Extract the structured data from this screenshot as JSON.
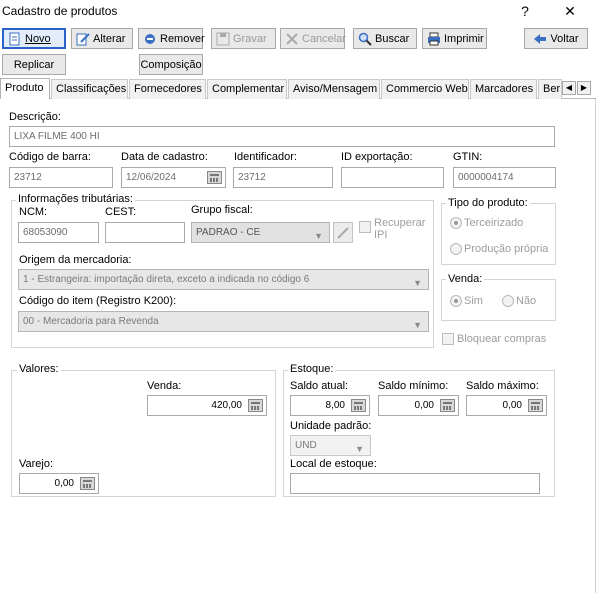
{
  "window": {
    "title": "Cadastro de produtos",
    "help_label": "?",
    "close_label": "✕"
  },
  "toolbar": {
    "novo": "Novo",
    "alterar": "Alterar",
    "remover": "Remover",
    "gravar": "Gravar",
    "cancelar": "Cancelar",
    "buscar": "Buscar",
    "imprimir": "Imprimir",
    "voltar": "Voltar",
    "replicar": "Replicar",
    "composicao": "Composição"
  },
  "tabs": [
    "Produto",
    "Classificações",
    "Fornecedores",
    "Complementar",
    "Aviso/Mensagem",
    "Commercio Web",
    "Marcadores",
    "Ber"
  ],
  "form": {
    "descricao_label": "Descrição:",
    "descricao": "LIXA FILME 400 HI",
    "codigo_barra_label": "Código de barra:",
    "codigo_barra": "23712",
    "data_cadastro_label": "Data de cadastro:",
    "data_cadastro": "12/06/2024",
    "identificador_label": "Identificador:",
    "identificador": "23712",
    "id_exportacao_label": "ID exportação:",
    "id_exportacao": "",
    "gtin_label": "GTIN:",
    "gtin": "0000004174"
  },
  "tributarias": {
    "title": "Informações tributárias:",
    "ncm_label": "NCM:",
    "ncm": "68053090",
    "cest_label": "CEST:",
    "cest": "",
    "grupo_fiscal_label": "Grupo fiscal:",
    "grupo_fiscal": "PADRAO - CE",
    "recuperar_ipi_label": "Recuperar IPI",
    "origem_label": "Origem da mercadoria:",
    "origem": "1 - Estrangeira: importação direta, exceto a indicada no código 6",
    "codigo_item_label": "Código do item (Registro K200):",
    "codigo_item": "00 - Mercadoria para Revenda"
  },
  "tipo_produto": {
    "title": "Tipo do produto:",
    "terceirizado": "Terceirizado",
    "producao_propria": "Produção própria"
  },
  "venda": {
    "title": "Venda:",
    "sim": "Sim",
    "nao": "Não"
  },
  "bloquear_compras": "Bloquear compras",
  "valores": {
    "title": "Valores:",
    "venda_label": "Venda:",
    "venda": "420,00",
    "varejo_label": "Varejo:",
    "varejo": "0,00"
  },
  "estoque": {
    "title": "Estoque:",
    "saldo_atual_label": "Saldo atual:",
    "saldo_atual": "8,00",
    "saldo_minimo_label": "Saldo mínimo:",
    "saldo_minimo": "0,00",
    "saldo_maximo_label": "Saldo máximo:",
    "saldo_maximo": "0,00",
    "unidade_label": "Unidade padrão:",
    "unidade": "UND",
    "local_label": "Local de estoque:",
    "local": ""
  }
}
